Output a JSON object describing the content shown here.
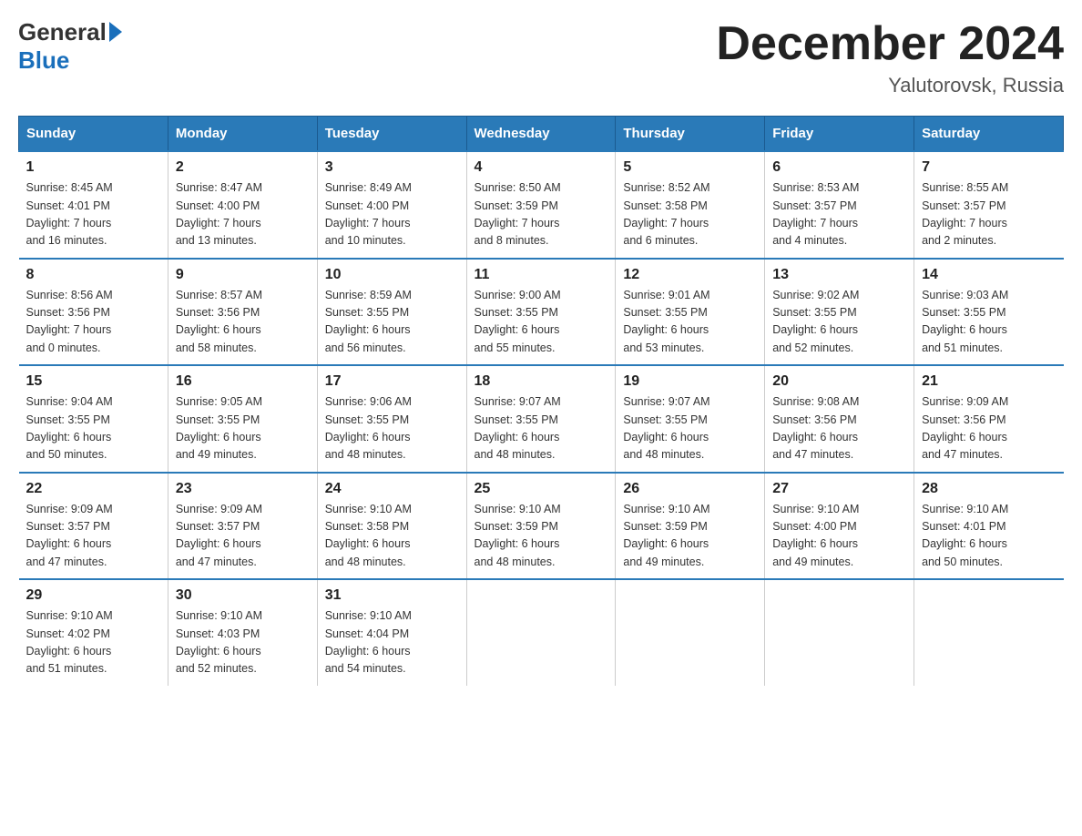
{
  "header": {
    "logo_general": "General",
    "logo_blue": "Blue",
    "month_title": "December 2024",
    "location": "Yalutorovsk, Russia"
  },
  "days_of_week": [
    "Sunday",
    "Monday",
    "Tuesday",
    "Wednesday",
    "Thursday",
    "Friday",
    "Saturday"
  ],
  "weeks": [
    [
      {
        "day": "1",
        "info": "Sunrise: 8:45 AM\nSunset: 4:01 PM\nDaylight: 7 hours\nand 16 minutes."
      },
      {
        "day": "2",
        "info": "Sunrise: 8:47 AM\nSunset: 4:00 PM\nDaylight: 7 hours\nand 13 minutes."
      },
      {
        "day": "3",
        "info": "Sunrise: 8:49 AM\nSunset: 4:00 PM\nDaylight: 7 hours\nand 10 minutes."
      },
      {
        "day": "4",
        "info": "Sunrise: 8:50 AM\nSunset: 3:59 PM\nDaylight: 7 hours\nand 8 minutes."
      },
      {
        "day": "5",
        "info": "Sunrise: 8:52 AM\nSunset: 3:58 PM\nDaylight: 7 hours\nand 6 minutes."
      },
      {
        "day": "6",
        "info": "Sunrise: 8:53 AM\nSunset: 3:57 PM\nDaylight: 7 hours\nand 4 minutes."
      },
      {
        "day": "7",
        "info": "Sunrise: 8:55 AM\nSunset: 3:57 PM\nDaylight: 7 hours\nand 2 minutes."
      }
    ],
    [
      {
        "day": "8",
        "info": "Sunrise: 8:56 AM\nSunset: 3:56 PM\nDaylight: 7 hours\nand 0 minutes."
      },
      {
        "day": "9",
        "info": "Sunrise: 8:57 AM\nSunset: 3:56 PM\nDaylight: 6 hours\nand 58 minutes."
      },
      {
        "day": "10",
        "info": "Sunrise: 8:59 AM\nSunset: 3:55 PM\nDaylight: 6 hours\nand 56 minutes."
      },
      {
        "day": "11",
        "info": "Sunrise: 9:00 AM\nSunset: 3:55 PM\nDaylight: 6 hours\nand 55 minutes."
      },
      {
        "day": "12",
        "info": "Sunrise: 9:01 AM\nSunset: 3:55 PM\nDaylight: 6 hours\nand 53 minutes."
      },
      {
        "day": "13",
        "info": "Sunrise: 9:02 AM\nSunset: 3:55 PM\nDaylight: 6 hours\nand 52 minutes."
      },
      {
        "day": "14",
        "info": "Sunrise: 9:03 AM\nSunset: 3:55 PM\nDaylight: 6 hours\nand 51 minutes."
      }
    ],
    [
      {
        "day": "15",
        "info": "Sunrise: 9:04 AM\nSunset: 3:55 PM\nDaylight: 6 hours\nand 50 minutes."
      },
      {
        "day": "16",
        "info": "Sunrise: 9:05 AM\nSunset: 3:55 PM\nDaylight: 6 hours\nand 49 minutes."
      },
      {
        "day": "17",
        "info": "Sunrise: 9:06 AM\nSunset: 3:55 PM\nDaylight: 6 hours\nand 48 minutes."
      },
      {
        "day": "18",
        "info": "Sunrise: 9:07 AM\nSunset: 3:55 PM\nDaylight: 6 hours\nand 48 minutes."
      },
      {
        "day": "19",
        "info": "Sunrise: 9:07 AM\nSunset: 3:55 PM\nDaylight: 6 hours\nand 48 minutes."
      },
      {
        "day": "20",
        "info": "Sunrise: 9:08 AM\nSunset: 3:56 PM\nDaylight: 6 hours\nand 47 minutes."
      },
      {
        "day": "21",
        "info": "Sunrise: 9:09 AM\nSunset: 3:56 PM\nDaylight: 6 hours\nand 47 minutes."
      }
    ],
    [
      {
        "day": "22",
        "info": "Sunrise: 9:09 AM\nSunset: 3:57 PM\nDaylight: 6 hours\nand 47 minutes."
      },
      {
        "day": "23",
        "info": "Sunrise: 9:09 AM\nSunset: 3:57 PM\nDaylight: 6 hours\nand 47 minutes."
      },
      {
        "day": "24",
        "info": "Sunrise: 9:10 AM\nSunset: 3:58 PM\nDaylight: 6 hours\nand 48 minutes."
      },
      {
        "day": "25",
        "info": "Sunrise: 9:10 AM\nSunset: 3:59 PM\nDaylight: 6 hours\nand 48 minutes."
      },
      {
        "day": "26",
        "info": "Sunrise: 9:10 AM\nSunset: 3:59 PM\nDaylight: 6 hours\nand 49 minutes."
      },
      {
        "day": "27",
        "info": "Sunrise: 9:10 AM\nSunset: 4:00 PM\nDaylight: 6 hours\nand 49 minutes."
      },
      {
        "day": "28",
        "info": "Sunrise: 9:10 AM\nSunset: 4:01 PM\nDaylight: 6 hours\nand 50 minutes."
      }
    ],
    [
      {
        "day": "29",
        "info": "Sunrise: 9:10 AM\nSunset: 4:02 PM\nDaylight: 6 hours\nand 51 minutes."
      },
      {
        "day": "30",
        "info": "Sunrise: 9:10 AM\nSunset: 4:03 PM\nDaylight: 6 hours\nand 52 minutes."
      },
      {
        "day": "31",
        "info": "Sunrise: 9:10 AM\nSunset: 4:04 PM\nDaylight: 6 hours\nand 54 minutes."
      },
      {
        "day": "",
        "info": ""
      },
      {
        "day": "",
        "info": ""
      },
      {
        "day": "",
        "info": ""
      },
      {
        "day": "",
        "info": ""
      }
    ]
  ]
}
